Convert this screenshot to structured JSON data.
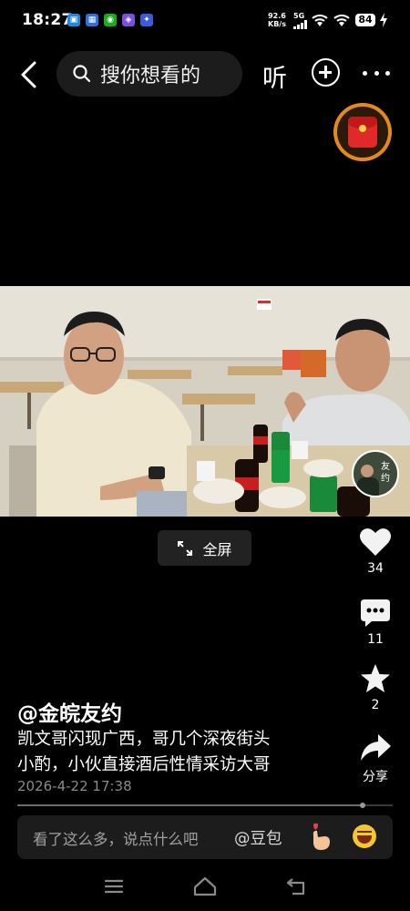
{
  "status_bar": {
    "time": "18:27",
    "net_speed_value": "92.6",
    "net_speed_unit": "KB/s",
    "signal_label": "5G",
    "battery": "84",
    "notification_icons": [
      "app-icon-blue",
      "app-icon-blue",
      "wechat-icon",
      "app-icon-purple",
      "app-icon-blue"
    ]
  },
  "top_nav": {
    "search_placeholder": "搜你想看的",
    "listen_label": "听"
  },
  "video": {
    "fullscreen_label": "全屏"
  },
  "actions": {
    "likes": "34",
    "comments": "11",
    "favorites": "2",
    "share_label": "分享"
  },
  "post": {
    "author": "@金皖友约",
    "caption_line1": "凯文哥闪现广西，哥几个深夜街头",
    "caption_line2": "小酌，小伙直接酒后性情采访大哥",
    "date": "2026-4-22 17:38",
    "progress": 0.92
  },
  "comment_bar": {
    "placeholder": "看了这么多，说点什么吧",
    "mention": "@豆包"
  },
  "avatar_text": "友约",
  "colors": {
    "background": "#000000",
    "accent_orange": "#e58a1a",
    "red_packet": "#e02a2a"
  }
}
